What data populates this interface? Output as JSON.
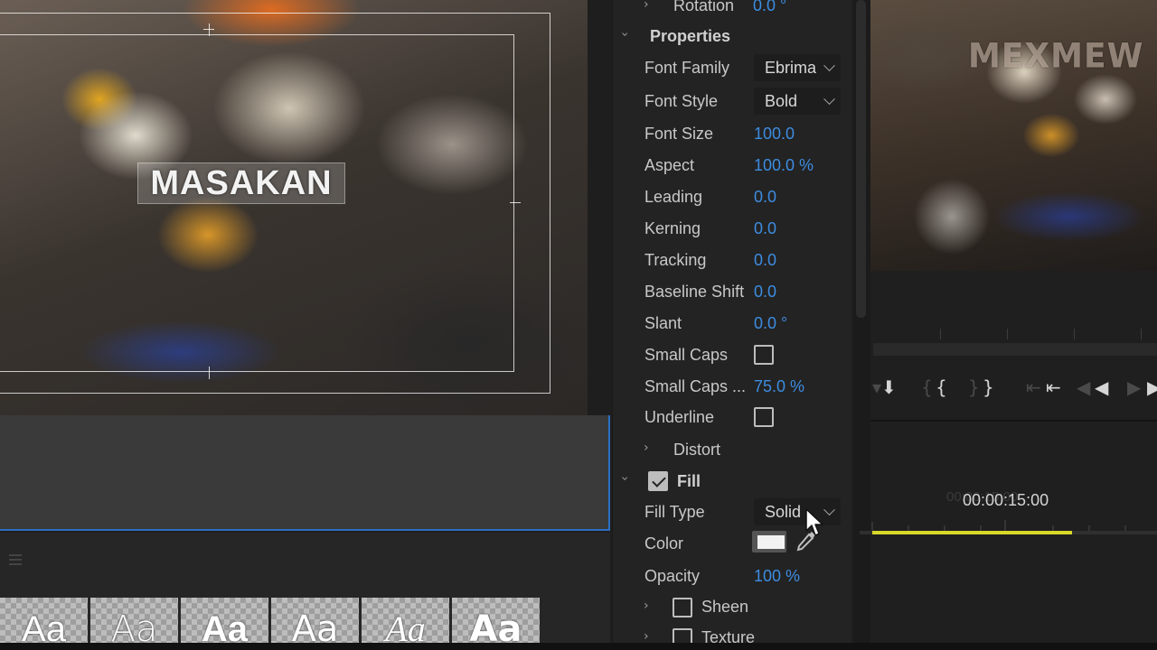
{
  "preview": {
    "title_text": "MASAKAN"
  },
  "font_styles": {
    "swatches": [
      "Aa",
      "Aa",
      "Aa",
      "Aa",
      "Aa",
      "Aa"
    ]
  },
  "essential_graphics": {
    "rotation": {
      "label": "Rotation",
      "value": "0.0 °"
    },
    "properties_header": "Properties",
    "font_family": {
      "label": "Font Family",
      "value": "Ebrima"
    },
    "font_style": {
      "label": "Font Style",
      "value": "Bold"
    },
    "font_size": {
      "label": "Font Size",
      "value": "100.0"
    },
    "aspect": {
      "label": "Aspect",
      "value": "100.0 %"
    },
    "leading": {
      "label": "Leading",
      "value": "0.0"
    },
    "kerning": {
      "label": "Kerning",
      "value": "0.0"
    },
    "tracking": {
      "label": "Tracking",
      "value": "0.0"
    },
    "baseline_shift": {
      "label": "Baseline Shift",
      "value": "0.0"
    },
    "slant": {
      "label": "Slant",
      "value": "0.0 °"
    },
    "small_caps": {
      "label": "Small Caps",
      "checked": false
    },
    "small_caps_size": {
      "label": "Small Caps ...",
      "value": "75.0 %"
    },
    "underline": {
      "label": "Underline",
      "checked": false
    },
    "distort": {
      "label": "Distort"
    },
    "fill": {
      "label": "Fill",
      "checked": true
    },
    "fill_type": {
      "label": "Fill Type",
      "value": "Solid"
    },
    "color": {
      "label": "Color",
      "value_hex": "#f2f2f2"
    },
    "opacity": {
      "label": "Opacity",
      "value": "100 %"
    },
    "sheen": {
      "label": "Sheen",
      "checked": false
    },
    "texture": {
      "label": "Texture",
      "checked": false
    }
  },
  "program_monitor": {
    "watermark": "MEXMEW"
  },
  "timeline": {
    "timecode": "00:00:15:00",
    "work_area_color": "#d8d82a"
  },
  "colors": {
    "accent_blue": "#3d8ce0",
    "panel_bg": "#232323",
    "selection_border": "#2b6fc2"
  }
}
